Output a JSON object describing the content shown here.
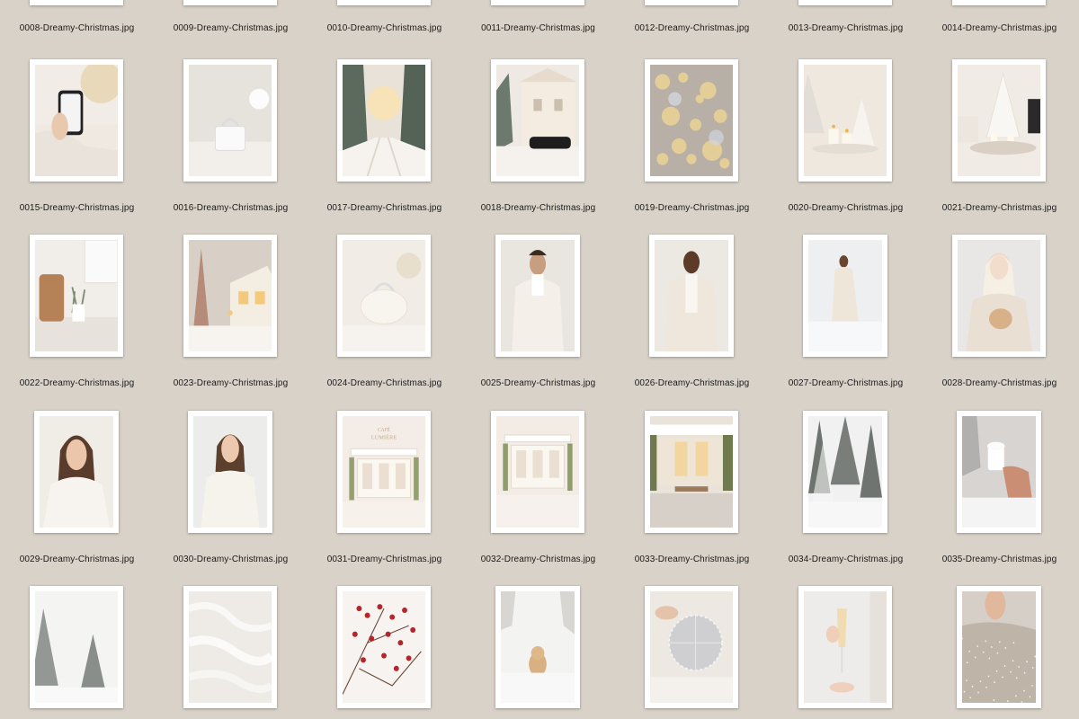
{
  "view": {
    "background_color": "#d9d2c8",
    "file_extension": ".jpg"
  },
  "files": [
    {
      "name": "0008-Dreamy-Christmas.jpg"
    },
    {
      "name": "0009-Dreamy-Christmas.jpg"
    },
    {
      "name": "0010-Dreamy-Christmas.jpg"
    },
    {
      "name": "0011-Dreamy-Christmas.jpg"
    },
    {
      "name": "0012-Dreamy-Christmas.jpg"
    },
    {
      "name": "0013-Dreamy-Christmas.jpg"
    },
    {
      "name": "0014-Dreamy-Christmas.jpg"
    },
    {
      "name": "0015-Dreamy-Christmas.jpg",
      "icon": "phone-in-hand-image"
    },
    {
      "name": "0016-Dreamy-Christmas.jpg",
      "icon": "white-handbag-image"
    },
    {
      "name": "0017-Dreamy-Christmas.jpg",
      "icon": "snowy-forest-road-image"
    },
    {
      "name": "0018-Dreamy-Christmas.jpg",
      "icon": "house-with-car-image"
    },
    {
      "name": "0019-Dreamy-Christmas.jpg",
      "icon": "bokeh-lights-image"
    },
    {
      "name": "0020-Dreamy-Christmas.jpg",
      "icon": "candles-tree-image"
    },
    {
      "name": "0021-Dreamy-Christmas.jpg",
      "icon": "white-tree-tray-image"
    },
    {
      "name": "0022-Dreamy-Christmas.jpg",
      "icon": "kitchen-board-image"
    },
    {
      "name": "0023-Dreamy-Christmas.jpg",
      "icon": "snowy-house-image"
    },
    {
      "name": "0024-Dreamy-Christmas.jpg",
      "icon": "fur-handbag-image"
    },
    {
      "name": "0025-Dreamy-Christmas.jpg",
      "icon": "man-fur-coat-image"
    },
    {
      "name": "0026-Dreamy-Christmas.jpg",
      "icon": "man-cream-coat-image"
    },
    {
      "name": "0027-Dreamy-Christmas.jpg",
      "icon": "runway-model-image"
    },
    {
      "name": "0028-Dreamy-Christmas.jpg",
      "icon": "woman-with-puppy-image"
    },
    {
      "name": "0029-Dreamy-Christmas.jpg",
      "icon": "woman-fur-portrait-image"
    },
    {
      "name": "0030-Dreamy-Christmas.jpg",
      "icon": "woman-fur-coat-image"
    },
    {
      "name": "0031-Dreamy-Christmas.jpg",
      "icon": "cafe-lumiere-image"
    },
    {
      "name": "0032-Dreamy-Christmas.jpg",
      "icon": "cafe-storefront-image"
    },
    {
      "name": "0033-Dreamy-Christmas.jpg",
      "icon": "cafe-street-image"
    },
    {
      "name": "0034-Dreamy-Christmas.jpg",
      "icon": "snowy-pines-image"
    },
    {
      "name": "0035-Dreamy-Christmas.jpg",
      "icon": "hot-cocoa-cup-image"
    },
    {
      "icon": "snowy-trees-image"
    },
    {
      "icon": "white-fur-texture-image"
    },
    {
      "icon": "red-berries-image"
    },
    {
      "icon": "puppy-in-snow-image"
    },
    {
      "icon": "disco-ball-image"
    },
    {
      "icon": "champagne-glass-image"
    },
    {
      "icon": "sparkly-dress-image"
    }
  ]
}
